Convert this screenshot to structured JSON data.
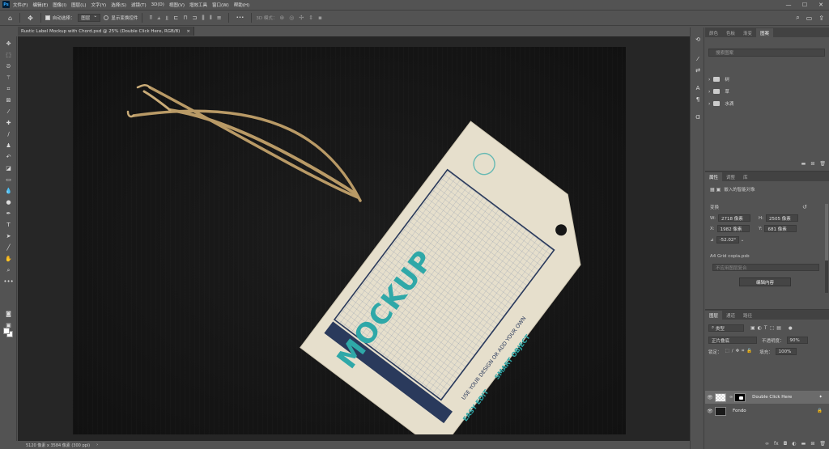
{
  "app": {
    "logo": "Ps",
    "menu": [
      "文件(F)",
      "编辑(E)",
      "图像(I)",
      "图层(L)",
      "文字(Y)",
      "选择(S)",
      "滤镜(T)",
      "3D(D)",
      "视图(V)",
      "增效工具",
      "窗口(W)",
      "帮助(H)"
    ],
    "window_controls": [
      "—",
      "☐",
      "✕"
    ]
  },
  "options": {
    "home": "⌂",
    "move": "✥",
    "auto_select_label": "自动选择：",
    "auto_select_value": "图层",
    "show_transform_label": "显示变换控件",
    "more": "•••",
    "mode_3d": "3D 模式：",
    "right_icons": [
      "⌕",
      "▭",
      "⇪"
    ]
  },
  "document": {
    "tab_title": "Rustic Label Mockup with Chord.psd @ 25% (Double Click Here, RGB/8)",
    "close": "×",
    "status": "5120 像素 x 3584 像素 (300 ppi)",
    "status_arrow": "›"
  },
  "mockup": {
    "headline": "MOCKUP",
    "line1": "USE YOUR DESIGN OR ADD YOUR OWN",
    "line2": "EASY EDIT",
    "line3": "SMART OBJECT"
  },
  "panels": {
    "top_tabs": [
      "颜色",
      "色板",
      "渐变",
      "图案"
    ],
    "top_active": 3,
    "search_placeholder": "搜索图案",
    "folders": [
      "树",
      "草",
      "水滴"
    ],
    "props_tabs": [
      "属性",
      "调整",
      "库"
    ],
    "props_active": 0,
    "props_type": "嵌入的智能对象",
    "transform_label": "变换",
    "w_label": "W:",
    "w_value": "2718 像素",
    "h_label": "H:",
    "h_value": "2505 像素",
    "x_label": "X:",
    "x_value": "1982 像素",
    "y_label": "Y:",
    "y_value": "681 像素",
    "angle_value": "-52.02°",
    "file_name": "A4 Grid copia.psb",
    "comp_placeholder": "不应用图层复合",
    "edit_button": "编辑内容",
    "layers_tabs": [
      "图层",
      "通道",
      "路径"
    ],
    "layers_active": 0,
    "filter_kind": "类型",
    "blend_mode": "正片叠底",
    "opacity_label": "不透明度：",
    "opacity_value": "90%",
    "lock_label": "锁定：",
    "fill_label": "填充：",
    "fill_value": "100%",
    "layers": [
      {
        "name": "Double Click Here",
        "selected": true
      },
      {
        "name": "Fondo",
        "selected": false
      }
    ]
  },
  "colors": {
    "accent_teal": "#2fa8a8",
    "navy": "#2a3a5c",
    "paper": "#e6dfcc"
  }
}
